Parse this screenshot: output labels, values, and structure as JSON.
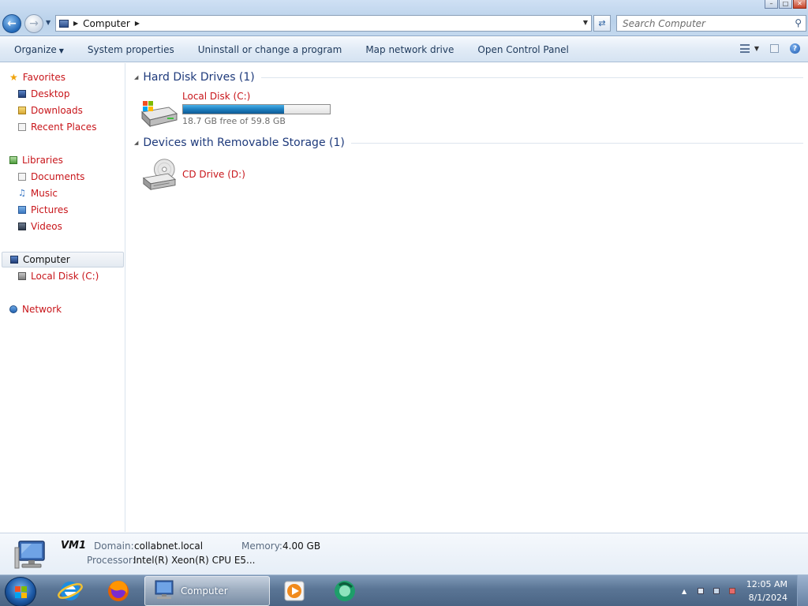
{
  "window": {
    "caption_minimize": "–",
    "caption_maximize": "□",
    "caption_close": "✕"
  },
  "nav": {
    "back_icon": "back-arrow-icon",
    "forward_icon": "forward-arrow-icon",
    "address_crumbs": [
      "Computer"
    ],
    "search_placeholder": "Search Computer"
  },
  "toolbar": {
    "organize": "Organize",
    "system_properties": "System properties",
    "uninstall": "Uninstall or change a program",
    "map_drive": "Map network drive",
    "control_panel": "Open Control Panel"
  },
  "sidebar": {
    "favorites": {
      "label": "Favorites",
      "items": [
        "Desktop",
        "Downloads",
        "Recent Places"
      ]
    },
    "libraries": {
      "label": "Libraries",
      "items": [
        "Documents",
        "Music",
        "Pictures",
        "Videos"
      ]
    },
    "computer": {
      "label": "Computer",
      "items": [
        "Local Disk (C:)"
      ]
    },
    "network": {
      "label": "Network"
    }
  },
  "content": {
    "groups": [
      {
        "title": "Hard Disk Drives (1)",
        "items": [
          {
            "name": "Local Disk (C:)",
            "free_text": "18.7 GB free of 59.8 GB",
            "used_fraction": 0.69
          }
        ]
      },
      {
        "title": "Devices with Removable Storage (1)",
        "items": [
          {
            "name": "CD Drive (D:)"
          }
        ]
      }
    ]
  },
  "details": {
    "computer_name": "VM1",
    "domain_label": "Domain:",
    "domain_value": "collabnet.local",
    "memory_label": "Memory:",
    "memory_value": "4.00 GB",
    "processor_label": "Processor:",
    "processor_value": "Intel(R) Xeon(R) CPU E5..."
  },
  "taskbar": {
    "active_task": "Computer",
    "pinned": [
      "internet-explorer-icon",
      "firefox-icon",
      "media-player-icon",
      "app-icon"
    ],
    "clock_time": "12:05 AM",
    "clock_date": "8/1/2024"
  },
  "colors": {
    "link_red": "#c8161b",
    "group_title_blue": "#1e3a7b",
    "usage_bar": "#1d7fbf"
  }
}
